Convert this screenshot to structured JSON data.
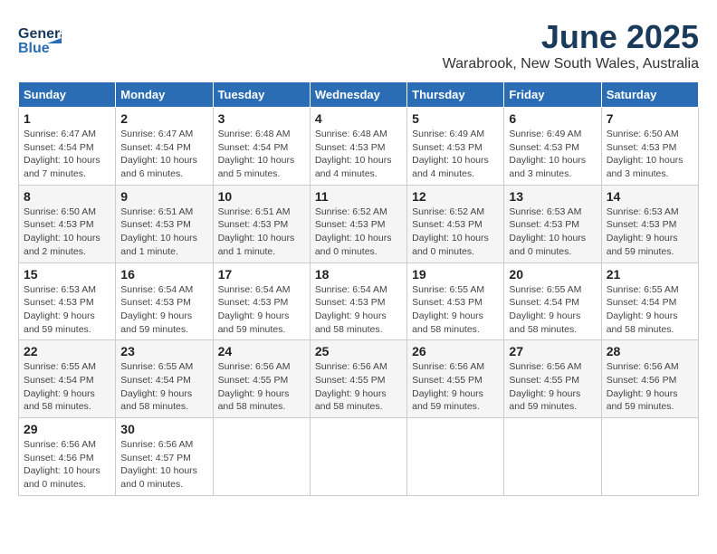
{
  "header": {
    "logo_line1": "General",
    "logo_line2": "Blue",
    "month": "June 2025",
    "location": "Warabrook, New South Wales, Australia"
  },
  "days_of_week": [
    "Sunday",
    "Monday",
    "Tuesday",
    "Wednesday",
    "Thursday",
    "Friday",
    "Saturday"
  ],
  "weeks": [
    [
      {
        "day": "1",
        "sunrise": "6:47 AM",
        "sunset": "4:54 PM",
        "daylight": "10 hours and 7 minutes."
      },
      {
        "day": "2",
        "sunrise": "6:47 AM",
        "sunset": "4:54 PM",
        "daylight": "10 hours and 6 minutes."
      },
      {
        "day": "3",
        "sunrise": "6:48 AM",
        "sunset": "4:54 PM",
        "daylight": "10 hours and 5 minutes."
      },
      {
        "day": "4",
        "sunrise": "6:48 AM",
        "sunset": "4:53 PM",
        "daylight": "10 hours and 4 minutes."
      },
      {
        "day": "5",
        "sunrise": "6:49 AM",
        "sunset": "4:53 PM",
        "daylight": "10 hours and 4 minutes."
      },
      {
        "day": "6",
        "sunrise": "6:49 AM",
        "sunset": "4:53 PM",
        "daylight": "10 hours and 3 minutes."
      },
      {
        "day": "7",
        "sunrise": "6:50 AM",
        "sunset": "4:53 PM",
        "daylight": "10 hours and 3 minutes."
      }
    ],
    [
      {
        "day": "8",
        "sunrise": "6:50 AM",
        "sunset": "4:53 PM",
        "daylight": "10 hours and 2 minutes."
      },
      {
        "day": "9",
        "sunrise": "6:51 AM",
        "sunset": "4:53 PM",
        "daylight": "10 hours and 1 minute."
      },
      {
        "day": "10",
        "sunrise": "6:51 AM",
        "sunset": "4:53 PM",
        "daylight": "10 hours and 1 minute."
      },
      {
        "day": "11",
        "sunrise": "6:52 AM",
        "sunset": "4:53 PM",
        "daylight": "10 hours and 0 minutes."
      },
      {
        "day": "12",
        "sunrise": "6:52 AM",
        "sunset": "4:53 PM",
        "daylight": "10 hours and 0 minutes."
      },
      {
        "day": "13",
        "sunrise": "6:53 AM",
        "sunset": "4:53 PM",
        "daylight": "10 hours and 0 minutes."
      },
      {
        "day": "14",
        "sunrise": "6:53 AM",
        "sunset": "4:53 PM",
        "daylight": "9 hours and 59 minutes."
      }
    ],
    [
      {
        "day": "15",
        "sunrise": "6:53 AM",
        "sunset": "4:53 PM",
        "daylight": "9 hours and 59 minutes."
      },
      {
        "day": "16",
        "sunrise": "6:54 AM",
        "sunset": "4:53 PM",
        "daylight": "9 hours and 59 minutes."
      },
      {
        "day": "17",
        "sunrise": "6:54 AM",
        "sunset": "4:53 PM",
        "daylight": "9 hours and 59 minutes."
      },
      {
        "day": "18",
        "sunrise": "6:54 AM",
        "sunset": "4:53 PM",
        "daylight": "9 hours and 58 minutes."
      },
      {
        "day": "19",
        "sunrise": "6:55 AM",
        "sunset": "4:53 PM",
        "daylight": "9 hours and 58 minutes."
      },
      {
        "day": "20",
        "sunrise": "6:55 AM",
        "sunset": "4:54 PM",
        "daylight": "9 hours and 58 minutes."
      },
      {
        "day": "21",
        "sunrise": "6:55 AM",
        "sunset": "4:54 PM",
        "daylight": "9 hours and 58 minutes."
      }
    ],
    [
      {
        "day": "22",
        "sunrise": "6:55 AM",
        "sunset": "4:54 PM",
        "daylight": "9 hours and 58 minutes."
      },
      {
        "day": "23",
        "sunrise": "6:55 AM",
        "sunset": "4:54 PM",
        "daylight": "9 hours and 58 minutes."
      },
      {
        "day": "24",
        "sunrise": "6:56 AM",
        "sunset": "4:55 PM",
        "daylight": "9 hours and 58 minutes."
      },
      {
        "day": "25",
        "sunrise": "6:56 AM",
        "sunset": "4:55 PM",
        "daylight": "9 hours and 58 minutes."
      },
      {
        "day": "26",
        "sunrise": "6:56 AM",
        "sunset": "4:55 PM",
        "daylight": "9 hours and 59 minutes."
      },
      {
        "day": "27",
        "sunrise": "6:56 AM",
        "sunset": "4:55 PM",
        "daylight": "9 hours and 59 minutes."
      },
      {
        "day": "28",
        "sunrise": "6:56 AM",
        "sunset": "4:56 PM",
        "daylight": "9 hours and 59 minutes."
      }
    ],
    [
      {
        "day": "29",
        "sunrise": "6:56 AM",
        "sunset": "4:56 PM",
        "daylight": "10 hours and 0 minutes."
      },
      {
        "day": "30",
        "sunrise": "6:56 AM",
        "sunset": "4:57 PM",
        "daylight": "10 hours and 0 minutes."
      },
      null,
      null,
      null,
      null,
      null
    ]
  ],
  "labels": {
    "sunrise_prefix": "Sunrise: ",
    "sunset_prefix": "Sunset: ",
    "daylight_prefix": "Daylight: "
  }
}
